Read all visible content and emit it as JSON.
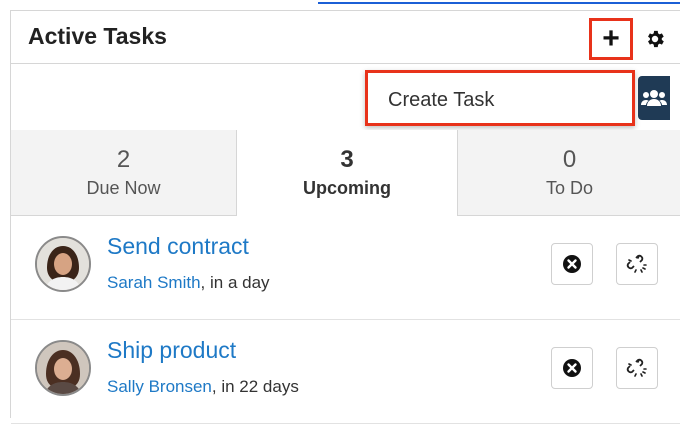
{
  "dashlet": {
    "title": "Active Tasks",
    "add_symbol": "+",
    "create_menu": {
      "item": "Create Task"
    }
  },
  "tabs": [
    {
      "count": "2",
      "label": "Due Now"
    },
    {
      "count": "3",
      "label": "Upcoming"
    },
    {
      "count": "0",
      "label": "To Do"
    }
  ],
  "tasks": [
    {
      "name": "Send contract",
      "assignee": "Sarah Smith",
      "due": ", in a day"
    },
    {
      "name": "Ship product",
      "assignee": "Sally Bronsen",
      "due": ", in 22 days"
    }
  ],
  "colors": {
    "accent": "#1e79c6",
    "highlight": "#e8321a",
    "team_button": "#1f3a55"
  }
}
